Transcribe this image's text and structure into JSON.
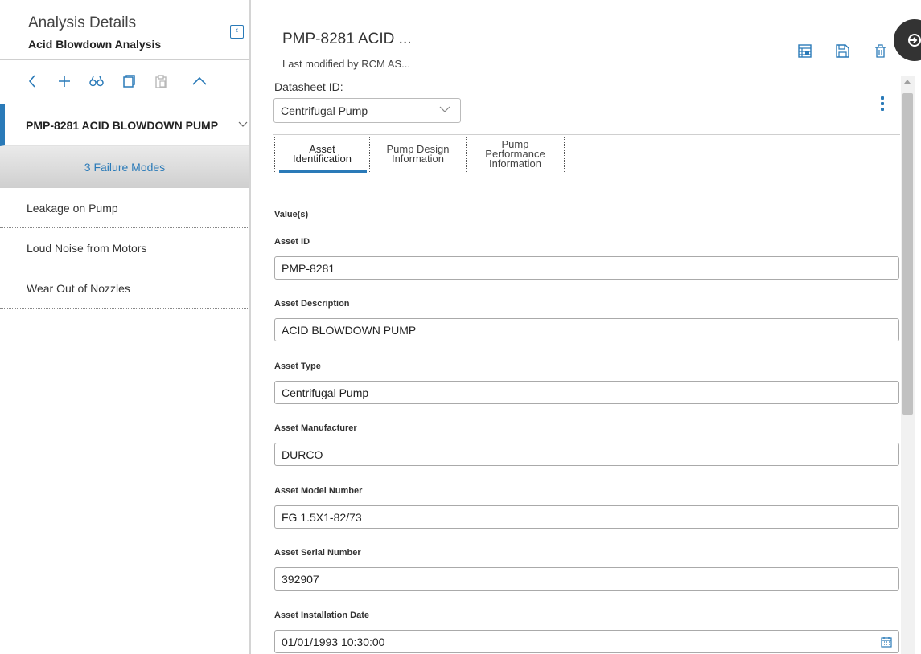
{
  "left": {
    "title": "Analysis Details",
    "subtitle": "Acid Blowdown Analysis",
    "collapse_glyph": "‹",
    "toolbar_icons": [
      "chevron-left-icon",
      "plus-icon",
      "binoculars-icon",
      "copy-icon",
      "paste-icon",
      "chevron-up-icon"
    ],
    "asset_name": "PMP-8281 ACID BLOWDOWN PUMP",
    "failure_modes_label": "3 Failure Modes",
    "failure_modes": [
      "Leakage on Pump",
      "Loud Noise from Motors",
      "Wear Out of Nozzles"
    ]
  },
  "header": {
    "title": "PMP-8281 ACID ...",
    "modified": "Last modified by RCM AS...",
    "action_icons": [
      "datasheet-icon",
      "save-icon",
      "delete-icon"
    ],
    "fab_icon": "sign-in-icon"
  },
  "datasheet": {
    "label": "Datasheet ID:",
    "selected": "Centrifugal Pump"
  },
  "tabs": [
    {
      "line1": "Asset",
      "line2": "Identification"
    },
    {
      "line1": "Pump Design",
      "line2": "Information"
    },
    {
      "line1": "Pump",
      "line2": "Performance",
      "line3": "Information"
    }
  ],
  "form": {
    "values_header": "Value(s)",
    "fields": [
      {
        "label": "Asset ID",
        "value": "PMP-8281"
      },
      {
        "label": "Asset Description",
        "value": "ACID BLOWDOWN PUMP"
      },
      {
        "label": "Asset Type",
        "value": "Centrifugal Pump"
      },
      {
        "label": "Asset Manufacturer",
        "value": "DURCO"
      },
      {
        "label": "Asset Model Number",
        "value": "FG 1.5X1-82/73"
      },
      {
        "label": "Asset Serial Number",
        "value": "392907"
      },
      {
        "label": "Asset Installation Date",
        "value": "01/01/1993 10:30:00"
      }
    ]
  },
  "colors": {
    "accent": "#2a7ab8",
    "fab": "#333333"
  }
}
